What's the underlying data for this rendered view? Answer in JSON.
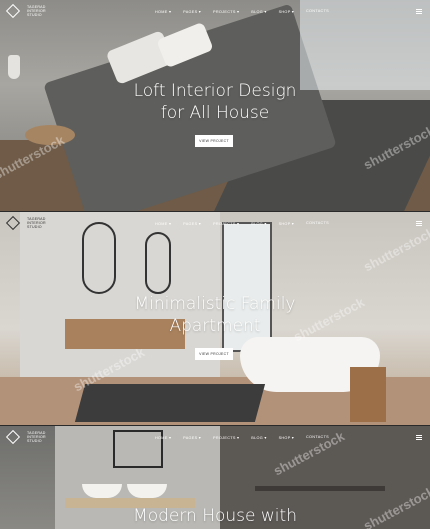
{
  "brand": {
    "logo_text": "TAGERAD\nINTERIOR\nSTUDIO"
  },
  "nav": [
    {
      "label": "HOME ▾"
    },
    {
      "label": "PAGES ▾"
    },
    {
      "label": "PROJECTS ▾"
    },
    {
      "label": "BLOG ▾"
    },
    {
      "label": "SHOP ▾"
    },
    {
      "label": "CONTACTS"
    }
  ],
  "slides": [
    {
      "title": "Loft Interior Design for All House",
      "button_label": "VIEW PROJECT"
    },
    {
      "title": "Minimalistic Family Apartment",
      "button_label": "VIEW PROJECT"
    },
    {
      "title": "Modern House with"
    }
  ],
  "watermark": "shutterstock",
  "colors": {
    "header_text": "#ffffff",
    "button_bg": "#ffffff",
    "button_text": "#333333"
  }
}
